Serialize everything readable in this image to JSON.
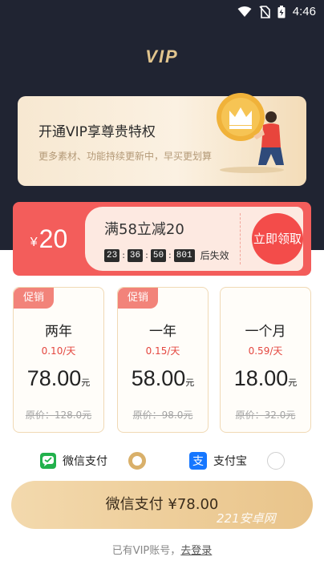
{
  "status_bar": {
    "time": "4:46"
  },
  "header": {
    "title": "VIP"
  },
  "hero": {
    "title": "开通VIP享尊贵特权",
    "subtitle": "更多素材、功能持续更新中，早买更划算"
  },
  "coupon": {
    "currency": "¥",
    "amount": "20",
    "title": "满58立减20",
    "timer": {
      "h": "23",
      "m": "36",
      "s": "50",
      "ms": "801"
    },
    "expire_text": "后失效",
    "claim_label": "立即领取"
  },
  "plans": [
    {
      "badge": "促销",
      "name": "两年",
      "daily": "0.10/天",
      "price": "78.00",
      "unit": "元",
      "original": "原价：128.0元"
    },
    {
      "badge": "促销",
      "name": "一年",
      "daily": "0.15/天",
      "price": "58.00",
      "unit": "元",
      "original": "原价：98.0元"
    },
    {
      "badge": "",
      "name": "一个月",
      "daily": "0.59/天",
      "price": "18.00",
      "unit": "元",
      "original": "原价：32.0元"
    }
  ],
  "payment": {
    "wechat_label": "微信支付",
    "alipay_label": "支付宝",
    "selected": "wechat",
    "pay_button_label": "微信支付 ¥78.00"
  },
  "watermark": "221安卓网",
  "login": {
    "prompt": "已有VIP账号，",
    "link": "去登录"
  },
  "colors": {
    "accent_gold": "#e2c58e",
    "coupon_red": "#f35d5b",
    "price_red": "#e4473f",
    "wechat_green": "#22b14c",
    "alipay_blue": "#1677ff"
  }
}
